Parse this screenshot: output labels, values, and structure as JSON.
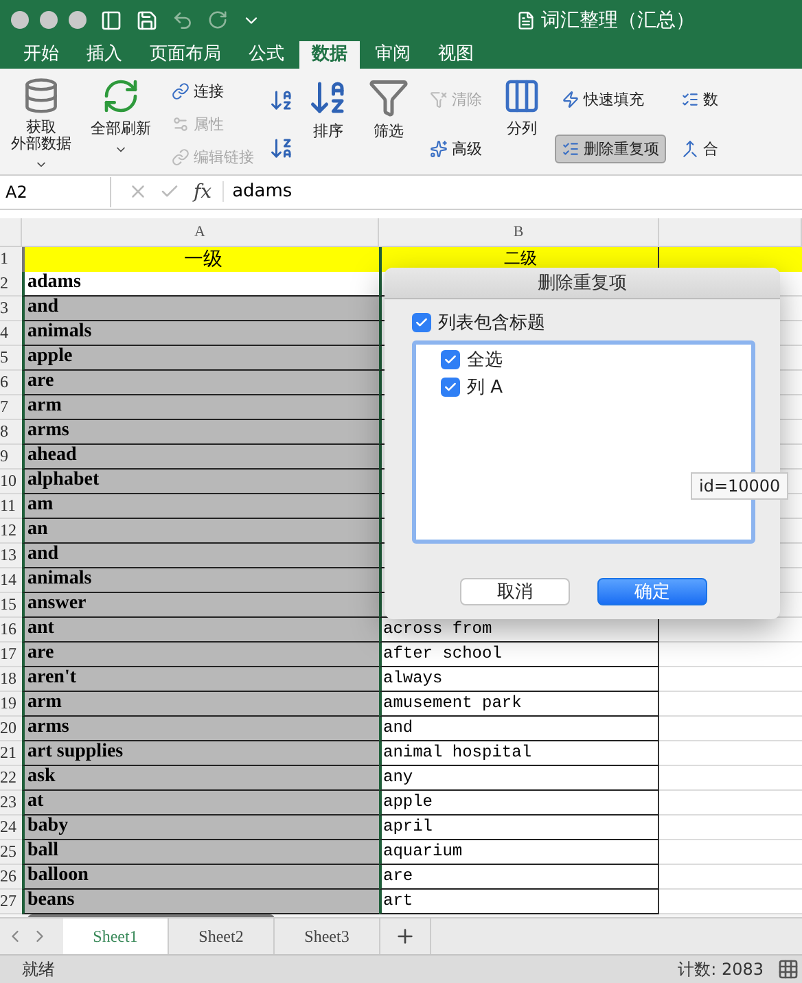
{
  "window": {
    "title": "词汇整理（汇总）"
  },
  "ribbon_tabs": [
    {
      "label": "开始",
      "selected": false
    },
    {
      "label": "插入",
      "selected": false
    },
    {
      "label": "页面布局",
      "selected": false
    },
    {
      "label": "公式",
      "selected": false
    },
    {
      "label": "数据",
      "selected": true
    },
    {
      "label": "审阅",
      "selected": false
    },
    {
      "label": "视图",
      "selected": false
    }
  ],
  "ribbon": [
    {
      "kind": "large",
      "lines": [
        "获取",
        "外部数据"
      ],
      "dropdown": true
    },
    {
      "kind": "large",
      "label": "全部刷新",
      "dropdown": true
    },
    {
      "kind": "stack",
      "items": [
        {
          "label": "连接",
          "disabled": false
        },
        {
          "label": "属性",
          "disabled": true
        },
        {
          "label": "编辑链接",
          "disabled": true
        }
      ]
    },
    {
      "kind": "icons"
    },
    {
      "kind": "large",
      "label": "排序",
      "dropdown": false
    },
    {
      "kind": "large",
      "label": "筛选",
      "dropdown": false
    },
    {
      "kind": "stack",
      "items": [
        {
          "label": "清除",
          "disabled": true
        },
        {
          "label": "高级",
          "disabled": false
        }
      ]
    },
    {
      "kind": "large",
      "label": "分列",
      "dropdown": false
    },
    {
      "kind": "stack",
      "items": [
        {
          "label": "快速填充",
          "disabled": false,
          "pressed": false
        },
        {
          "label": "删除重复项",
          "disabled": false,
          "pressed": true
        }
      ]
    },
    {
      "kind": "stack",
      "items": [
        {
          "label": "数",
          "disabled": false
        },
        {
          "label": "合",
          "disabled": false
        }
      ]
    }
  ],
  "formula_bar": {
    "name_box": "A2",
    "function_label": "fx",
    "value": "adams"
  },
  "sheet": {
    "columns": [
      "A",
      "B"
    ],
    "rows": [
      {
        "number": "1",
        "a": "一级",
        "b": "二级",
        "kind": "header",
        "selected": false
      },
      {
        "number": "2",
        "a": "adams",
        "kind": "data",
        "selected": true,
        "active": true
      },
      {
        "number": "3",
        "a": "and",
        "kind": "data",
        "selected": true,
        "active": false
      },
      {
        "number": "4",
        "a": "animals",
        "kind": "data",
        "selected": true,
        "active": false
      },
      {
        "number": "5",
        "a": "apple",
        "kind": "data",
        "selected": true,
        "active": false
      },
      {
        "number": "6",
        "a": "are",
        "kind": "data",
        "selected": true,
        "active": false
      },
      {
        "number": "7",
        "a": "arm",
        "kind": "data",
        "selected": true,
        "active": false
      },
      {
        "number": "8",
        "a": "arms",
        "kind": "data",
        "selected": true,
        "active": false
      },
      {
        "number": "9",
        "a": "ahead",
        "kind": "data",
        "selected": true,
        "active": false
      },
      {
        "number": "10",
        "a": "alphabet",
        "kind": "data",
        "selected": true,
        "active": false
      },
      {
        "number": "11",
        "a": "am",
        "kind": "data",
        "selected": true,
        "active": false
      },
      {
        "number": "12",
        "a": "an",
        "kind": "data",
        "selected": true,
        "active": false
      },
      {
        "number": "13",
        "a": "and",
        "kind": "data",
        "selected": true,
        "active": false
      },
      {
        "number": "14",
        "a": "animals",
        "kind": "data",
        "selected": true,
        "active": false
      },
      {
        "number": "15",
        "a": "answer",
        "kind": "data",
        "selected": true,
        "active": false
      },
      {
        "number": "16",
        "a": "ant",
        "b": "across from",
        "kind": "data",
        "selected": true,
        "active": false
      },
      {
        "number": "17",
        "a": "are",
        "b": "after school",
        "kind": "data",
        "selected": true,
        "active": false
      },
      {
        "number": "18",
        "a": "aren't",
        "b": "always",
        "kind": "data",
        "selected": true,
        "active": false
      },
      {
        "number": "19",
        "a": "arm",
        "b": "amusement park",
        "kind": "data",
        "selected": true,
        "active": false
      },
      {
        "number": "20",
        "a": "arms",
        "b": "and",
        "kind": "data",
        "selected": true,
        "active": false
      },
      {
        "number": "21",
        "a": "art supplies",
        "b": "animal hospital",
        "kind": "data",
        "selected": true,
        "active": false
      },
      {
        "number": "22",
        "a": "ask",
        "b": "any",
        "kind": "data",
        "selected": true,
        "active": false
      },
      {
        "number": "23",
        "a": "at",
        "b": "apple",
        "kind": "data",
        "selected": true,
        "active": false
      },
      {
        "number": "24",
        "a": "baby",
        "b": "april",
        "kind": "data",
        "selected": true,
        "active": false
      },
      {
        "number": "25",
        "a": "ball",
        "b": "aquarium",
        "kind": "data",
        "selected": true,
        "active": false
      },
      {
        "number": "26",
        "a": "balloon",
        "b": "are",
        "kind": "data",
        "selected": true,
        "active": false
      },
      {
        "number": "27",
        "a": "beans",
        "b": "art",
        "kind": "data",
        "selected": true,
        "active": false
      }
    ]
  },
  "dialog": {
    "title": "删除重复项",
    "header_checkbox": {
      "label": "列表包含标题",
      "checked": true
    },
    "columns": [
      {
        "label": "全选",
        "checked": true
      },
      {
        "label": "列 A",
        "checked": true
      }
    ],
    "buttons": [
      {
        "label": "取消",
        "default": false
      },
      {
        "label": "确定",
        "default": true
      }
    ]
  },
  "tooltip": "id=10000",
  "sheet_tabs": [
    {
      "label": "Sheet1",
      "selected": true
    },
    {
      "label": "Sheet2",
      "selected": false
    },
    {
      "label": "Sheet3",
      "selected": false
    }
  ],
  "status_bar": {
    "state": "就绪",
    "count": "计数: 2083"
  }
}
